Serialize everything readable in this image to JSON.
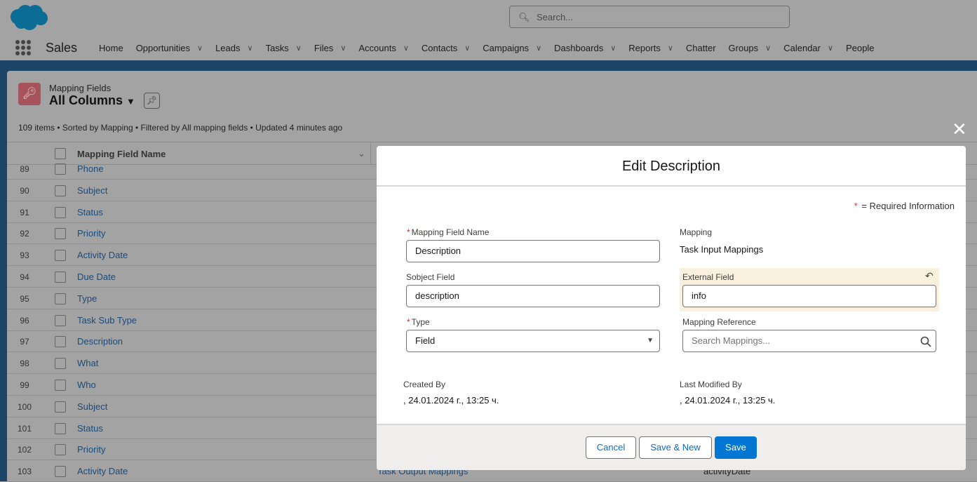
{
  "header": {
    "search_placeholder": "Search...",
    "app_name": "Sales",
    "nav": [
      "Home",
      "Opportunities",
      "Leads",
      "Tasks",
      "Files",
      "Accounts",
      "Contacts",
      "Campaigns",
      "Dashboards",
      "Reports",
      "Chatter",
      "Groups",
      "Calendar",
      "People"
    ],
    "nav_has_menu": [
      false,
      true,
      true,
      true,
      true,
      true,
      true,
      true,
      true,
      true,
      false,
      true,
      true,
      false
    ]
  },
  "list": {
    "object_label": "Mapping Fields",
    "view_name": "All Columns",
    "meta": "109 items • Sorted by Mapping • Filtered by All mapping fields • Updated 4 minutes ago",
    "column_header": "Mapping Field Name",
    "rows": [
      {
        "num": "89",
        "name": "Phone"
      },
      {
        "num": "90",
        "name": "Subject"
      },
      {
        "num": "91",
        "name": "Status"
      },
      {
        "num": "92",
        "name": "Priority"
      },
      {
        "num": "93",
        "name": "Activity Date"
      },
      {
        "num": "94",
        "name": "Due Date"
      },
      {
        "num": "95",
        "name": "Type"
      },
      {
        "num": "96",
        "name": "Task Sub Type"
      },
      {
        "num": "97",
        "name": "Description"
      },
      {
        "num": "98",
        "name": "What"
      },
      {
        "num": "99",
        "name": "Who"
      },
      {
        "num": "100",
        "name": "Subject"
      },
      {
        "num": "101",
        "name": "Status"
      },
      {
        "num": "102",
        "name": "Priority"
      },
      {
        "num": "103",
        "name": "Activity Date",
        "mapping": "Task Output Mappings",
        "external": "activityDate"
      }
    ]
  },
  "modal": {
    "title": "Edit Description",
    "required_note": "= Required Information",
    "required_star": "*",
    "name_label": "Mapping Field Name",
    "name_value": "Description",
    "mapping_label": "Mapping",
    "mapping_value": "Task Input Mappings",
    "subject_label": "Sobject Field",
    "subject_value": "description",
    "external_label": "External Field",
    "external_value": "info",
    "type_label": "Type",
    "type_value": "Field",
    "ref_label": "Mapping Reference",
    "ref_placeholder": "Search Mappings...",
    "created_label": "Created By",
    "created_value": ", 24.01.2024 г., 13:25 ч.",
    "modified_label": "Last Modified By",
    "modified_value": ", 24.01.2024 г., 13:25 ч.",
    "cancel": "Cancel",
    "save_new": "Save & New",
    "save": "Save"
  },
  "colors": {
    "brand": "#0176d3",
    "highlight": "#faf0de",
    "object_icon": "#a6535c"
  }
}
